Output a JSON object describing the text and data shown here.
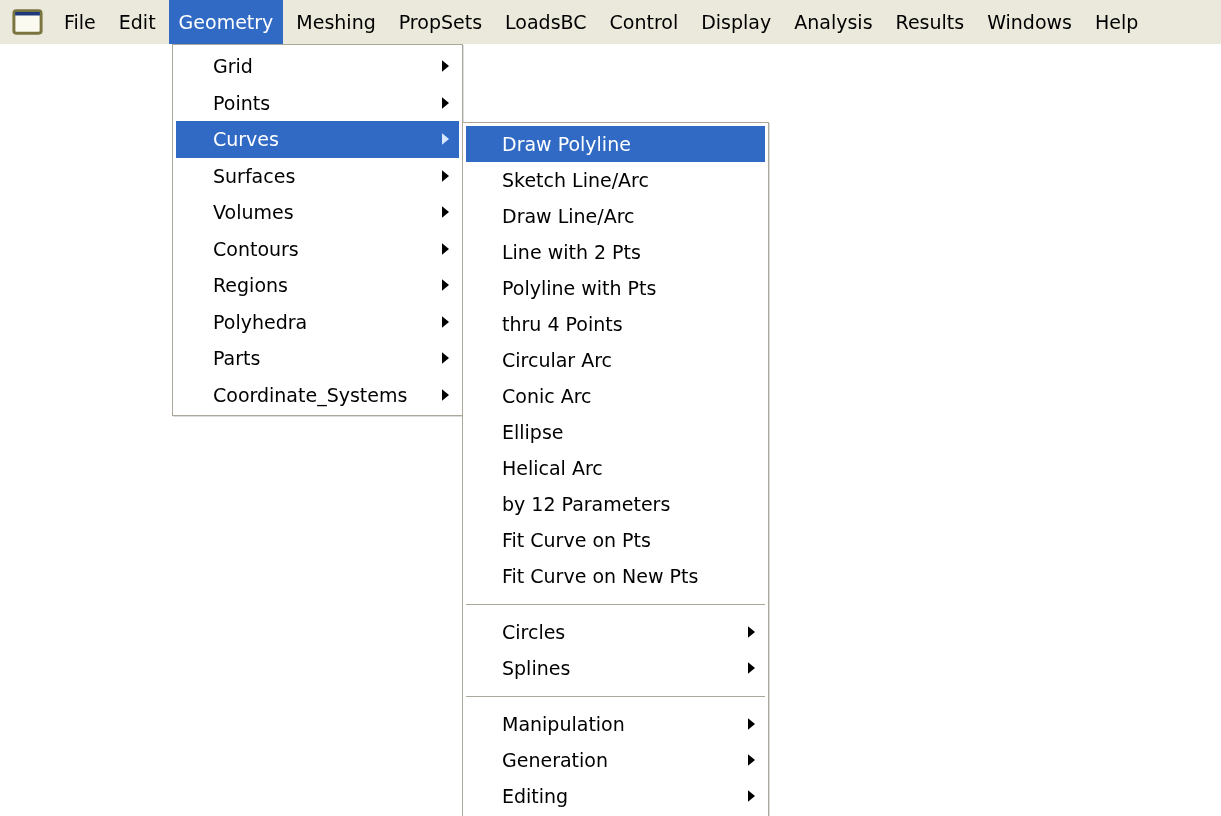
{
  "menubar": [
    {
      "label": "File",
      "selected": false
    },
    {
      "label": "Edit",
      "selected": false
    },
    {
      "label": "Geometry",
      "selected": true
    },
    {
      "label": "Meshing",
      "selected": false
    },
    {
      "label": "PropSets",
      "selected": false
    },
    {
      "label": "LoadsBC",
      "selected": false
    },
    {
      "label": "Control",
      "selected": false
    },
    {
      "label": "Display",
      "selected": false
    },
    {
      "label": "Analysis",
      "selected": false
    },
    {
      "label": "Results",
      "selected": false
    },
    {
      "label": "Windows",
      "selected": false
    },
    {
      "label": "Help",
      "selected": false
    }
  ],
  "geometry_menu": [
    {
      "label": "Grid",
      "has_submenu": true,
      "selected": false
    },
    {
      "label": "Points",
      "has_submenu": true,
      "selected": false
    },
    {
      "label": "Curves",
      "has_submenu": true,
      "selected": true
    },
    {
      "label": "Surfaces",
      "has_submenu": true,
      "selected": false
    },
    {
      "label": "Volumes",
      "has_submenu": true,
      "selected": false
    },
    {
      "label": "Contours",
      "has_submenu": true,
      "selected": false
    },
    {
      "label": "Regions",
      "has_submenu": true,
      "selected": false
    },
    {
      "label": "Polyhedra",
      "has_submenu": true,
      "selected": false
    },
    {
      "label": "Parts",
      "has_submenu": true,
      "selected": false
    },
    {
      "label": "Coordinate_Systems",
      "has_submenu": true,
      "selected": false
    }
  ],
  "curves_submenu": [
    {
      "kind": "item",
      "label": "Draw Polyline",
      "has_submenu": false,
      "selected": true
    },
    {
      "kind": "item",
      "label": "Sketch Line/Arc",
      "has_submenu": false,
      "selected": false
    },
    {
      "kind": "item",
      "label": "Draw Line/Arc",
      "has_submenu": false,
      "selected": false
    },
    {
      "kind": "item",
      "label": "Line with 2 Pts",
      "has_submenu": false,
      "selected": false
    },
    {
      "kind": "item",
      "label": "Polyline with Pts",
      "has_submenu": false,
      "selected": false
    },
    {
      "kind": "item",
      "label": "thru 4 Points",
      "has_submenu": false,
      "selected": false
    },
    {
      "kind": "item",
      "label": "Circular Arc",
      "has_submenu": false,
      "selected": false
    },
    {
      "kind": "item",
      "label": "Conic Arc",
      "has_submenu": false,
      "selected": false
    },
    {
      "kind": "item",
      "label": "Ellipse",
      "has_submenu": false,
      "selected": false
    },
    {
      "kind": "item",
      "label": "Helical Arc",
      "has_submenu": false,
      "selected": false
    },
    {
      "kind": "item",
      "label": "by 12 Parameters",
      "has_submenu": false,
      "selected": false
    },
    {
      "kind": "item",
      "label": "Fit Curve on Pts",
      "has_submenu": false,
      "selected": false
    },
    {
      "kind": "item",
      "label": "Fit Curve on New Pts",
      "has_submenu": false,
      "selected": false
    },
    {
      "kind": "separator"
    },
    {
      "kind": "item",
      "label": "Circles",
      "has_submenu": true,
      "selected": false
    },
    {
      "kind": "item",
      "label": "Splines",
      "has_submenu": true,
      "selected": false
    },
    {
      "kind": "separator"
    },
    {
      "kind": "item",
      "label": "Manipulation",
      "has_submenu": true,
      "selected": false
    },
    {
      "kind": "item",
      "label": "Generation",
      "has_submenu": true,
      "selected": false
    },
    {
      "kind": "item",
      "label": "Editing",
      "has_submenu": true,
      "selected": false
    }
  ]
}
